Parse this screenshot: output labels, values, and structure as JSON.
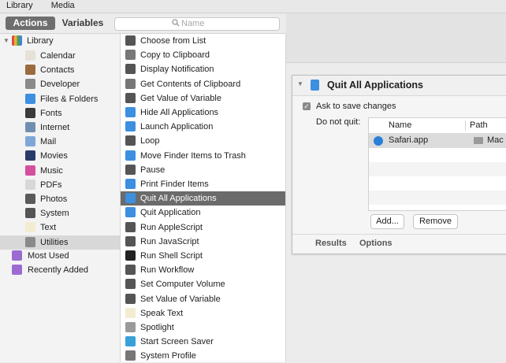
{
  "menubar": {
    "items": [
      "Library",
      "Media"
    ]
  },
  "toolbar": {
    "actions_tab": "Actions",
    "variables_tab": "Variables",
    "search_placeholder": "Name"
  },
  "library": {
    "root": "Library",
    "items": [
      {
        "label": "Calendar",
        "icon": "calendar-icon",
        "color": "#e7e2d8"
      },
      {
        "label": "Contacts",
        "icon": "contacts-icon",
        "color": "#9b6b3f"
      },
      {
        "label": "Developer",
        "icon": "developer-icon",
        "color": "#8a8a8a"
      },
      {
        "label": "Files & Folders",
        "icon": "finder-icon",
        "color": "#3d8fe0"
      },
      {
        "label": "Fonts",
        "icon": "fonts-icon",
        "color": "#3a3a3a"
      },
      {
        "label": "Internet",
        "icon": "internet-icon",
        "color": "#6f8fb0"
      },
      {
        "label": "Mail",
        "icon": "mail-icon",
        "color": "#7fa6d6"
      },
      {
        "label": "Movies",
        "icon": "movies-icon",
        "color": "#2a3a6a"
      },
      {
        "label": "Music",
        "icon": "music-icon",
        "color": "#d44f9c"
      },
      {
        "label": "PDFs",
        "icon": "pdf-icon",
        "color": "#d7d7d7"
      },
      {
        "label": "Photos",
        "icon": "photos-icon",
        "color": "#5a5a5a"
      },
      {
        "label": "System",
        "icon": "system-icon",
        "color": "#555555"
      },
      {
        "label": "Text",
        "icon": "text-icon",
        "color": "#f3ecd0"
      },
      {
        "label": "Utilities",
        "icon": "utilities-icon",
        "color": "#8a8a8a"
      }
    ],
    "smart": [
      {
        "label": "Most Used",
        "icon": "smart-folder-icon",
        "color": "#9b6bd1"
      },
      {
        "label": "Recently Added",
        "icon": "smart-folder-icon",
        "color": "#9b6bd1"
      }
    ]
  },
  "actions": [
    {
      "label": "Choose from List",
      "icon": "automator-icon",
      "color": "#555"
    },
    {
      "label": "Copy to Clipboard",
      "icon": "utilities-icon",
      "color": "#777"
    },
    {
      "label": "Display Notification",
      "icon": "automator-icon",
      "color": "#555"
    },
    {
      "label": "Get Contents of Clipboard",
      "icon": "utilities-icon",
      "color": "#777"
    },
    {
      "label": "Get Value of Variable",
      "icon": "automator-icon",
      "color": "#555"
    },
    {
      "label": "Hide All Applications",
      "icon": "finder-icon",
      "color": "#3d8fe0"
    },
    {
      "label": "Launch Application",
      "icon": "finder-icon",
      "color": "#3d8fe0"
    },
    {
      "label": "Loop",
      "icon": "automator-icon",
      "color": "#555"
    },
    {
      "label": "Move Finder Items to Trash",
      "icon": "finder-icon",
      "color": "#3d8fe0"
    },
    {
      "label": "Pause",
      "icon": "automator-icon",
      "color": "#555"
    },
    {
      "label": "Print Finder Items",
      "icon": "finder-icon",
      "color": "#3d8fe0"
    },
    {
      "label": "Quit All Applications",
      "icon": "finder-icon",
      "color": "#3d8fe0"
    },
    {
      "label": "Quit Application",
      "icon": "finder-icon",
      "color": "#3d8fe0"
    },
    {
      "label": "Run AppleScript",
      "icon": "automator-icon",
      "color": "#555"
    },
    {
      "label": "Run JavaScript",
      "icon": "automator-icon",
      "color": "#555"
    },
    {
      "label": "Run Shell Script",
      "icon": "terminal-icon",
      "color": "#222"
    },
    {
      "label": "Run Workflow",
      "icon": "automator-icon",
      "color": "#555"
    },
    {
      "label": "Set Computer Volume",
      "icon": "automator-icon",
      "color": "#555"
    },
    {
      "label": "Set Value of Variable",
      "icon": "automator-icon",
      "color": "#555"
    },
    {
      "label": "Speak Text",
      "icon": "text-icon",
      "color": "#f3ecd0"
    },
    {
      "label": "Spotlight",
      "icon": "spotlight-icon",
      "color": "#9a9a9a"
    },
    {
      "label": "Start Screen Saver",
      "icon": "screensaver-icon",
      "color": "#3aa0d8"
    },
    {
      "label": "System Profile",
      "icon": "utilities-icon",
      "color": "#777"
    }
  ],
  "selected_action": "Quit All Applications",
  "card": {
    "title": "Quit All Applications",
    "ask_label": "Ask to save changes",
    "ask_checked": true,
    "do_not_quit_label": "Do not quit:",
    "col_name": "Name",
    "col_path": "Path",
    "rows": [
      {
        "name": "Safari.app",
        "path": "Mac"
      }
    ],
    "add_button": "Add...",
    "remove_button": "Remove",
    "results_tab": "Results",
    "options_tab": "Options"
  }
}
